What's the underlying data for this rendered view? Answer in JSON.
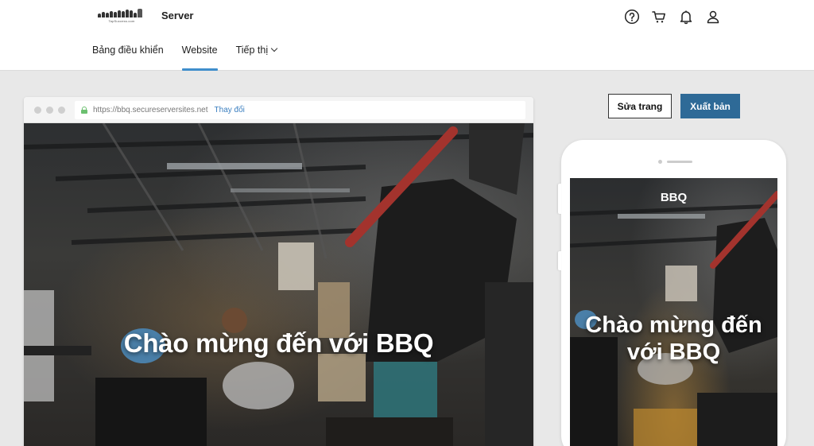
{
  "app": {
    "logo_text": "TapSuccess.com",
    "brand": "Server"
  },
  "top_icons": [
    "help-icon",
    "cart-icon",
    "bell-icon",
    "user-icon"
  ],
  "nav": {
    "items": [
      {
        "label": "Bảng điều khiển"
      },
      {
        "label": "Website",
        "active": true
      },
      {
        "label": "Tiếp thị"
      }
    ]
  },
  "browser": {
    "url": "https://bbq.secureserversites.net",
    "change_label": "Thay đổi"
  },
  "desktop_preview": {
    "hero_title": "Chào mừng đến với BBQ"
  },
  "actions": {
    "edit_label": "Sửa trang",
    "publish_label": "Xuất bản"
  },
  "mobile_preview": {
    "site_name": "BBQ",
    "hero_title": "Chào mừng đến với BBQ"
  },
  "colors": {
    "accent": "#3f8ecb",
    "publish_button": "#2e6a97",
    "lock": "#6cc070",
    "link": "#3b7fc0"
  }
}
